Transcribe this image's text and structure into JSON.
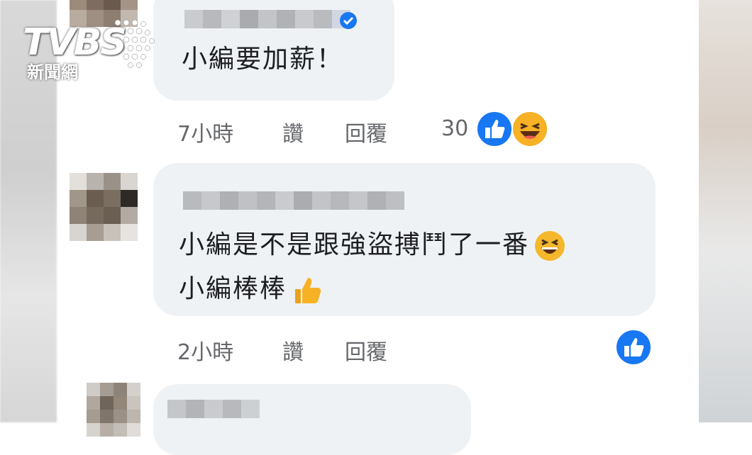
{
  "logo": {
    "main": "TVBS",
    "sub": "新聞網"
  },
  "comments": [
    {
      "text": "小編要加薪！",
      "time": "7小時",
      "like_action": "讚",
      "reply_action": "回覆",
      "reaction_count": "30",
      "reactions": [
        "like-icon",
        "laugh-emoji-icon"
      ],
      "verified": true
    },
    {
      "text_line1": "小編是不是跟強盜搏鬥了一番",
      "text_line2": "小編棒棒",
      "time": "2小時",
      "like_action": "讚",
      "reply_action": "回覆",
      "reactions": [
        "like-icon"
      ],
      "inline_emojis": [
        "grinning-squint-emoji-icon",
        "thumbs-up-emoji-icon"
      ]
    }
  ],
  "colors": {
    "bubble": "#eff2f5",
    "like_blue": "#1877f2",
    "secondary_text": "#65676b",
    "primary_text": "#1c1e21"
  }
}
